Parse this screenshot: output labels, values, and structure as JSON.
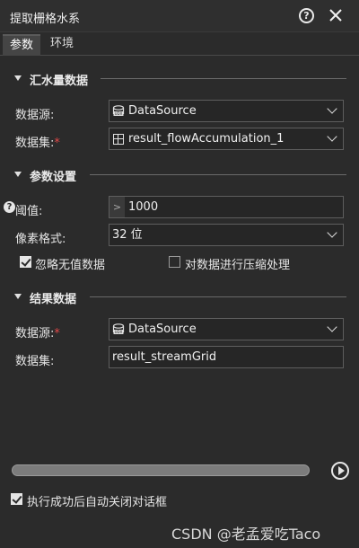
{
  "window": {
    "title": "提取栅格水系"
  },
  "tabs": [
    {
      "label": "参数",
      "active": true
    },
    {
      "label": "环境",
      "active": false
    }
  ],
  "sections": {
    "source": "汇水量数据",
    "params": "参数设置",
    "result": "结果数据"
  },
  "source": {
    "datasource_label": "数据源:",
    "datasource_value": "DataSource",
    "dataset_label": "数据集:",
    "dataset_required_mark": "*",
    "dataset_value": "result_flowAccumulation_1"
  },
  "params": {
    "threshold_label": "阈值:",
    "threshold_prefix": ">",
    "threshold_value": "1000",
    "pixel_format_label": "像素格式:",
    "pixel_format_value": "32 位",
    "ignore_nodata_label": "忽略无值数据",
    "ignore_nodata_checked": true,
    "compress_label": "对数据进行压缩处理",
    "compress_checked": false
  },
  "result": {
    "datasource_label": "数据源:",
    "datasource_required_mark": "*",
    "datasource_value": "DataSource",
    "dataset_label": "数据集:",
    "dataset_value": "result_streamGrid"
  },
  "footer": {
    "auto_close_label": "执行成功后自动关闭对话框",
    "auto_close_checked": true,
    "progress": 0
  },
  "watermark": "CSDN @老孟爱吃Taco",
  "colors": {
    "background": "#2b2b2b",
    "required": "#e04848",
    "field_border": "#5e5e5e"
  }
}
